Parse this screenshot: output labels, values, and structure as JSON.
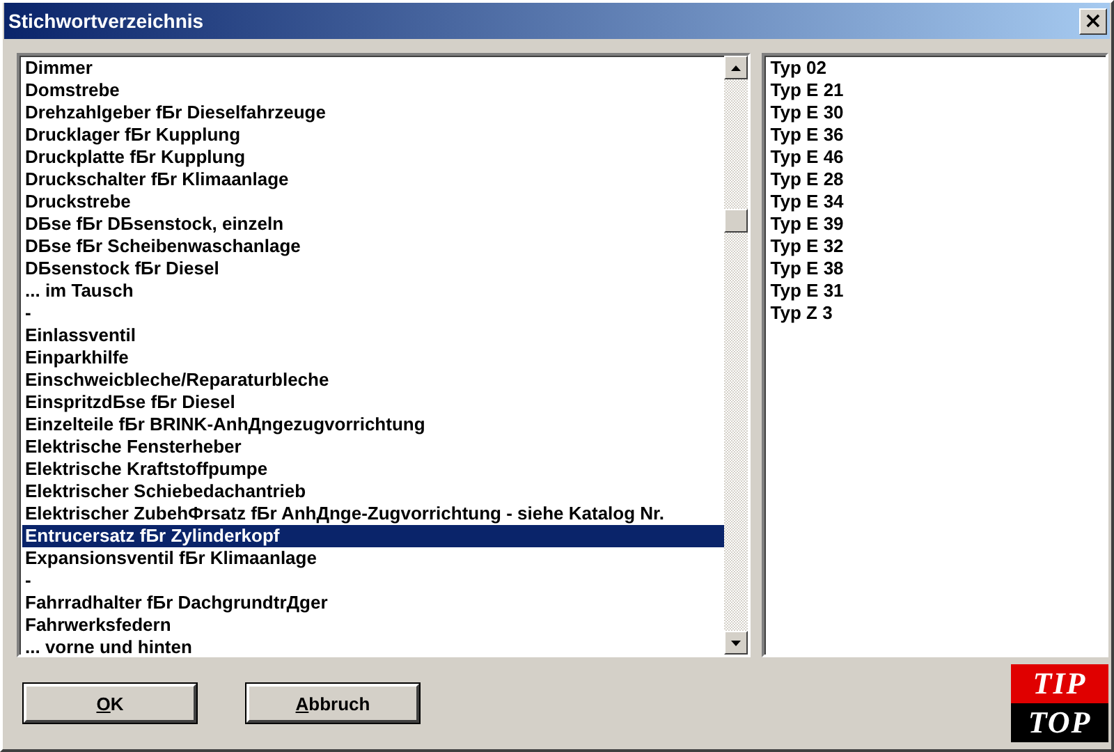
{
  "window": {
    "title": "Stichwortverzeichnis",
    "close": "×"
  },
  "keywords": [
    {
      "label": "Dimmer",
      "selected": false
    },
    {
      "label": "Domstrebe",
      "selected": false
    },
    {
      "label": "Drehzahlgeber fБr Dieselfahrzeuge",
      "selected": false
    },
    {
      "label": "Drucklager fБr Kupplung",
      "selected": false
    },
    {
      "label": "Druckplatte fБr Kupplung",
      "selected": false
    },
    {
      "label": "Druckschalter fБr Klimaanlage",
      "selected": false
    },
    {
      "label": "Druckstrebe",
      "selected": false
    },
    {
      "label": "DБse fБr DБsenstock, einzeln",
      "selected": false
    },
    {
      "label": "DБse fБr Scheibenwaschanlage",
      "selected": false
    },
    {
      "label": "DБsenstock fБr Diesel",
      "selected": false
    },
    {
      "label": "... im Tausch",
      "selected": false
    },
    {
      "label": "-",
      "selected": false
    },
    {
      "label": "Einlassventil",
      "selected": false
    },
    {
      "label": "Einparkhilfe",
      "selected": false
    },
    {
      "label": "Einschweicbleche/Reparaturbleche",
      "selected": false
    },
    {
      "label": "EinspritzdБse fБr Diesel",
      "selected": false
    },
    {
      "label": "Einzelteile fБr BRINK-AnhДngezugvorrichtung",
      "selected": false
    },
    {
      "label": "Elektrische Fensterheber",
      "selected": false
    },
    {
      "label": "Elektrische Kraftstoffpumpe",
      "selected": false
    },
    {
      "label": "Elektrischer Schiebedachantrieb",
      "selected": false
    },
    {
      "label": "Elektrischer ZubehФrsatz fБr AnhДnge-Zugvorrichtung - siehe Katalog Nr.",
      "selected": false
    },
    {
      "label": "Entrucersatz fБr Zylinderkopf",
      "selected": true
    },
    {
      "label": "Expansionsventil fБr Klimaanlage",
      "selected": false
    },
    {
      "label": "-",
      "selected": false
    },
    {
      "label": "Fahrradhalter fБr DachgrundtrДger",
      "selected": false
    },
    {
      "label": "Fahrwerksfedern",
      "selected": false
    },
    {
      "label": "... vorne und hinten",
      "selected": false
    }
  ],
  "types": [
    "Typ 02",
    "Typ E 21",
    "Typ E 30",
    "Typ E 36",
    "Typ E 46",
    "Typ E 28",
    "Typ E 34",
    "Typ E 39",
    "Typ E 32",
    "Typ E 38",
    "Typ E 31",
    "Typ Z 3"
  ],
  "buttons": [
    {
      "accel": "O",
      "rest": "K"
    },
    {
      "accel": "A",
      "rest": "bbruch"
    }
  ],
  "logo": {
    "top": "TIP",
    "bottom": "TOP"
  }
}
